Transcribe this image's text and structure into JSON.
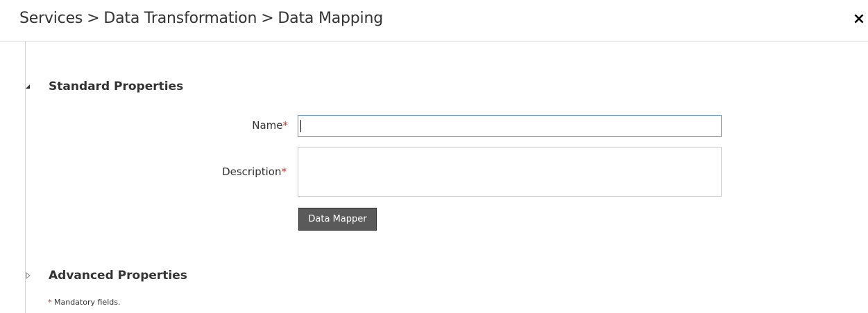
{
  "header": {
    "breadcrumb": [
      "Services",
      "Data Transformation",
      "Data Mapping"
    ],
    "separator": ">",
    "close_glyph": "×"
  },
  "sections": {
    "standard": {
      "title": "Standard Properties",
      "expanded": true,
      "icon": "triangle-down-icon"
    },
    "advanced": {
      "title": "Advanced Properties",
      "expanded": false,
      "icon": "triangle-right-icon"
    }
  },
  "form": {
    "name": {
      "label": "Name",
      "required_mark": "*",
      "value": ""
    },
    "description": {
      "label": "Description",
      "required_mark": "*",
      "value": ""
    },
    "data_mapper_button": "Data Mapper"
  },
  "footer": {
    "required_mark": "*",
    "note": "Mandatory fields."
  },
  "colors": {
    "required": "#d9322b",
    "button_bg": "#5a5a5a",
    "focus_border": "#5b8fb5"
  }
}
